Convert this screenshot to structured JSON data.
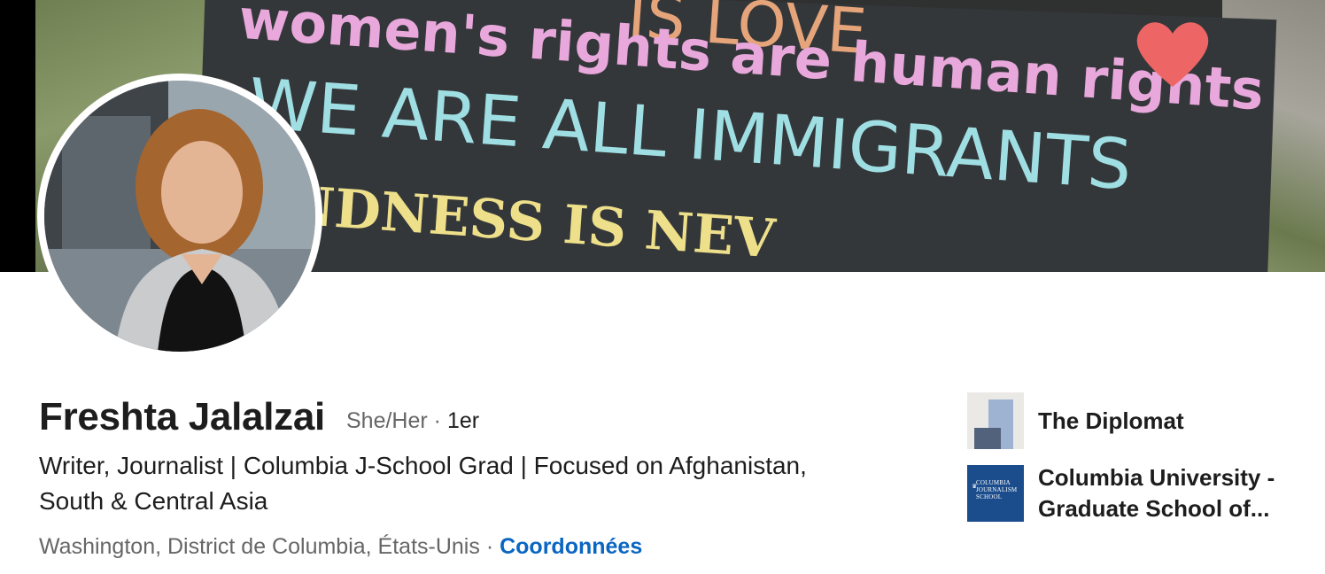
{
  "banner": {
    "sign_lines": [
      "IS LOVE",
      "women's rights are human rights",
      "WE ARE ALL IMMIGRANTS",
      "NDNESS IS NEV"
    ]
  },
  "profile": {
    "name": "Freshta Jalalzai",
    "pronouns": "She/Her",
    "separator": "·",
    "degree": "1er",
    "headline": "Writer, Journalist | Columbia J-School Grad | Focused on Afghanistan, South & Central Asia",
    "location": "Washington, District de Columbia, États-Unis",
    "contact_label": "Coordonnées"
  },
  "companies": [
    {
      "name": "The Diplomat",
      "logo": "diplomat-logo"
    },
    {
      "name": "Columbia University - Graduate School of...",
      "name_line1": "Columbia University -",
      "name_line2": "Graduate School of...",
      "logo": "columbia-journalism-logo",
      "logo_text": "COLUMBIA JOURNALISM SCHOOL",
      "logo_lines": [
        "COLUMBIA",
        "JOURNALISM",
        "SCHOOL"
      ]
    }
  ],
  "colors": {
    "link": "#0a66c2",
    "text": "#1d1d1d",
    "muted": "#666666"
  }
}
